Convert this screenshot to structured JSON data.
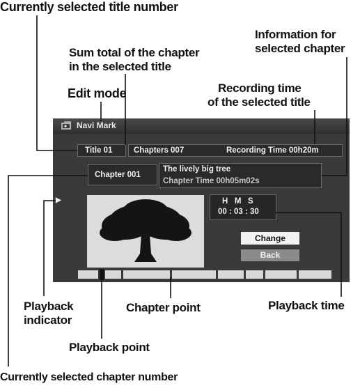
{
  "callouts": {
    "title_number": "Currently selected title number",
    "info_chapter_1": "Information for",
    "info_chapter_2": "selected chapter",
    "sum_total_1": "Sum total of the chapter",
    "sum_total_2": "in the selected title",
    "edit_mode": "Edit mode",
    "recording_time_1": "Recording time",
    "recording_time_2": "of the selected title",
    "playback_indicator_1": "Playback",
    "playback_indicator_2": "indicator",
    "chapter_point": "Chapter point",
    "playback_time": "Playback time",
    "playback_point": "Playback point",
    "chapter_number": "Currently  selected chapter number"
  },
  "screen": {
    "window_title": "Navi Mark",
    "title_field": "Title 01",
    "chapters_field": "Chapters 007",
    "recording_time_field": "Recording Time  00h20m",
    "chapter_field": "Chapter 001",
    "chapter_name": "The lively big tree",
    "chapter_time": "Chapter Time  00h05m02s",
    "time_header": "H   M   S",
    "time_value": "00 : 03 : 30",
    "change_button": "Change",
    "back_button": "Back",
    "play_indicator": "▶"
  },
  "colors": {
    "panel_bg": "#3a3a3a",
    "button_active": "#f2f2f2",
    "button_inactive": "#8a8a8a"
  }
}
